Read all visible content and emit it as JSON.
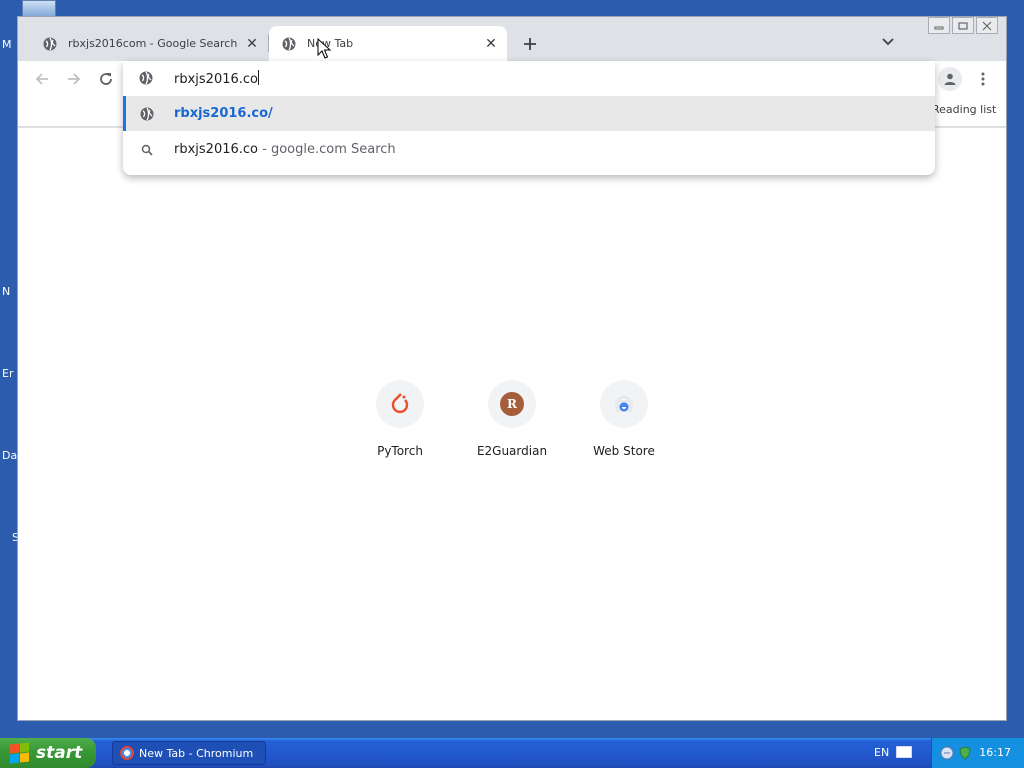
{
  "desktop": {
    "labels": [
      "M",
      "N",
      "Er",
      "Da",
      "S"
    ]
  },
  "tabs": [
    {
      "title": "rbxjs2016com - Google Search",
      "icon": "globe-icon",
      "active": false
    },
    {
      "title": "New Tab",
      "icon": "globe-icon",
      "active": true
    }
  ],
  "toolbar": {
    "reading_list": "Reading list"
  },
  "omnibox": {
    "input_value": "rbxjs2016.co",
    "suggestions": [
      {
        "text": "rbxjs2016.co/",
        "type": "url",
        "icon": "globe-icon",
        "selected": true
      },
      {
        "text": "rbxjs2016.co",
        "suffix": " - google.com Search",
        "type": "search",
        "icon": "search-icon",
        "selected": false
      }
    ]
  },
  "shortcuts": [
    {
      "label": "PyTorch",
      "icon": "pytorch-icon"
    },
    {
      "label": "E2Guardian",
      "icon": "letter-r-icon",
      "letter": "R"
    },
    {
      "label": "Web Store",
      "icon": "web-store-icon"
    }
  ],
  "taskbar": {
    "start_label": "start",
    "task_item": "New Tab - Chromium",
    "language": "EN",
    "clock": "16:17"
  },
  "colors": {
    "accent": "#1a73e8",
    "taskbar": "#2359cf",
    "start": "#3a9a37",
    "desktop": "#2b5cae"
  }
}
